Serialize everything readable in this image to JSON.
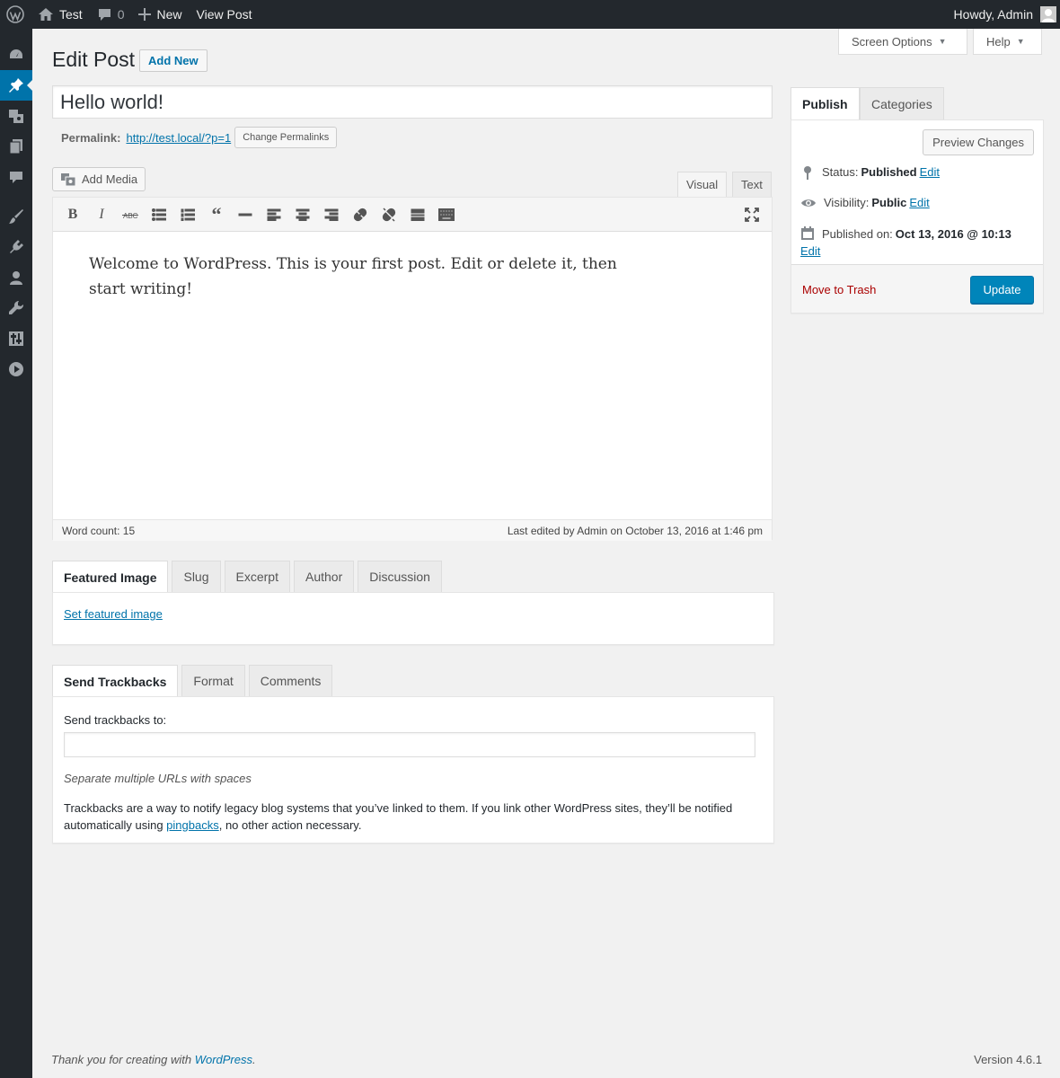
{
  "adminbar": {
    "site_name": "Test",
    "comments_count": "0",
    "new_label": "New",
    "view_post_label": "View Post",
    "howdy": "Howdy, Admin"
  },
  "screen_options": {
    "screen_options_label": "Screen Options",
    "help_label": "Help"
  },
  "header": {
    "title": "Edit Post",
    "add_new": "Add New"
  },
  "post": {
    "title": "Hello world!",
    "permalink_label": "Permalink:",
    "permalink_url": "http://test.local/?p=1",
    "change_permalinks": "Change Permalinks",
    "content": "Welcome to WordPress. This is your first post. Edit or delete it, then start writing!"
  },
  "editor": {
    "add_media": "Add Media",
    "tab_visual": "Visual",
    "tab_text": "Text",
    "word_count": "Word count: 15",
    "last_edited": "Last edited by Admin on October 13, 2016 at 1:46 pm"
  },
  "meta_tabs_1": {
    "featured_image": "Featured Image",
    "slug": "Slug",
    "excerpt": "Excerpt",
    "author": "Author",
    "discussion": "Discussion",
    "set_featured_image": "Set featured image"
  },
  "meta_tabs_2": {
    "send_trackbacks": "Send Trackbacks",
    "format": "Format",
    "comments": "Comments",
    "send_trackbacks_to": "Send trackbacks to:",
    "hint": "Separate multiple URLs with spaces",
    "desc_before": "Trackbacks are a way to notify legacy blog systems that you’ve linked to them. If you link other WordPress sites, they’ll be notified automatically using ",
    "pingbacks": "pingbacks",
    "desc_after": ", no other action necessary."
  },
  "publish": {
    "tab_publish": "Publish",
    "tab_categories": "Categories",
    "preview_changes": "Preview Changes",
    "status_label": "Status:",
    "status_value": "Published",
    "visibility_label": "Visibility:",
    "visibility_value": "Public",
    "published_label": "Published on:",
    "published_value": "Oct 13, 2016 @ 10:13",
    "edit": "Edit",
    "move_to_trash": "Move to Trash",
    "update": "Update"
  },
  "footer": {
    "thanks_before": "Thank you for creating with ",
    "wordpress": "WordPress",
    "thanks_after": ".",
    "version": "Version 4.6.1"
  },
  "colors": {
    "accent": "#0073aa",
    "primary_button": "#0085ba",
    "trash": "#aa0000",
    "admin_bar": "#23282d"
  }
}
